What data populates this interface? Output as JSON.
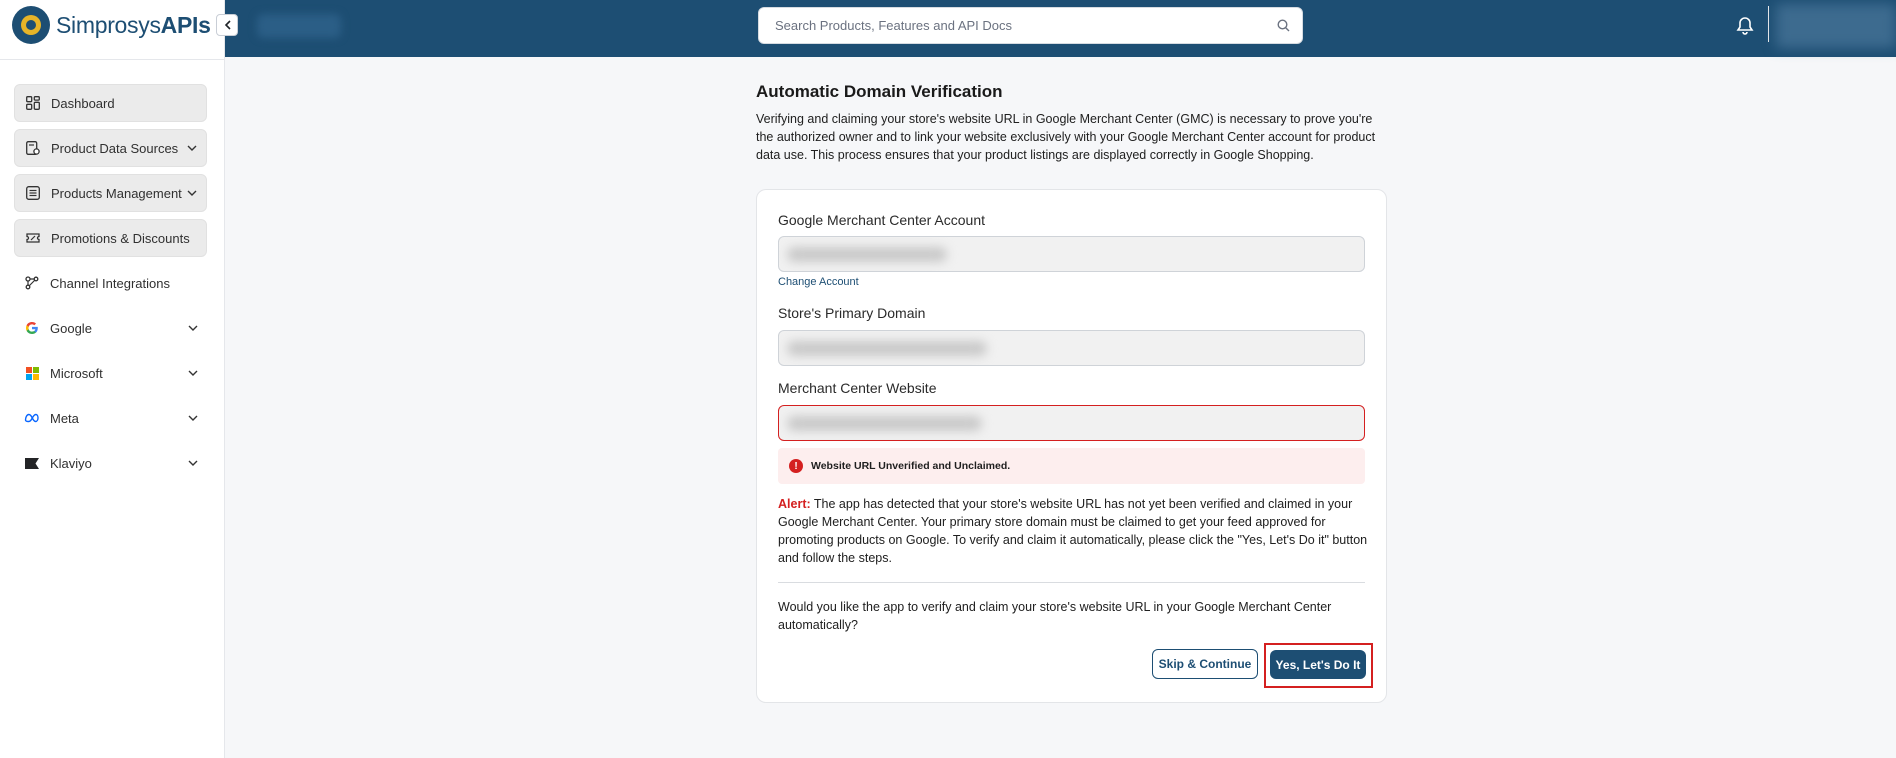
{
  "brand": {
    "name_light": "Simprosys",
    "name_bold": "APIs"
  },
  "sidebar": {
    "items": [
      {
        "label": "Dashboard",
        "icon": "dashboard-icon",
        "boxed": true,
        "chevron": false
      },
      {
        "label": "Product Data Sources",
        "icon": "data-sources-icon",
        "boxed": true,
        "chevron": true
      },
      {
        "label": "Products Management",
        "icon": "list-icon",
        "boxed": true,
        "chevron": true
      },
      {
        "label": "Promotions & Discounts",
        "icon": "ticket-icon",
        "boxed": true,
        "chevron": false
      },
      {
        "label": "Channel Integrations",
        "icon": "integrations-icon",
        "boxed": false,
        "chevron": false
      },
      {
        "label": "Google",
        "icon": "google-icon",
        "boxed": false,
        "chevron": true
      },
      {
        "label": "Microsoft",
        "icon": "microsoft-icon",
        "boxed": false,
        "chevron": true
      },
      {
        "label": "Meta",
        "icon": "meta-icon",
        "boxed": false,
        "chevron": true
      },
      {
        "label": "Klaviyo",
        "icon": "klaviyo-icon",
        "boxed": false,
        "chevron": true
      }
    ]
  },
  "header": {
    "search_placeholder": "Search Products, Features and API Docs"
  },
  "main": {
    "title": "Automatic Domain Verification",
    "description": "Verifying and claiming your store's website URL in Google Merchant Center (GMC) is necessary to prove you're the authorized owner and to link your website exclusively with your Google Merchant Center account for product data use. This process ensures that your product listings are displayed correctly in Google Shopping.",
    "gmc_label": "Google Merchant Center Account",
    "change_account": "Change Account",
    "domain_label": "Store's Primary Domain",
    "website_label": "Merchant Center Website",
    "error_message": "Website URL Unverified and Unclaimed.",
    "alert_key": "Alert:",
    "alert_text": " The app has detected that your store's website URL has not yet been verified and claimed in your Google Merchant Center. Your primary store domain must be claimed to get your feed approved for promoting products on Google. To verify and claim it automatically, please click the \"Yes, Let's Do it\" button and follow the steps.",
    "question": "Would you like the app to verify and claim your store's website URL in your Google Merchant Center automatically?",
    "skip_button": "Skip & Continue",
    "confirm_button": "Yes, Let's Do It"
  },
  "colors": {
    "brand": "#1d4e73",
    "error": "#d42020",
    "accent": "#e7b428"
  }
}
